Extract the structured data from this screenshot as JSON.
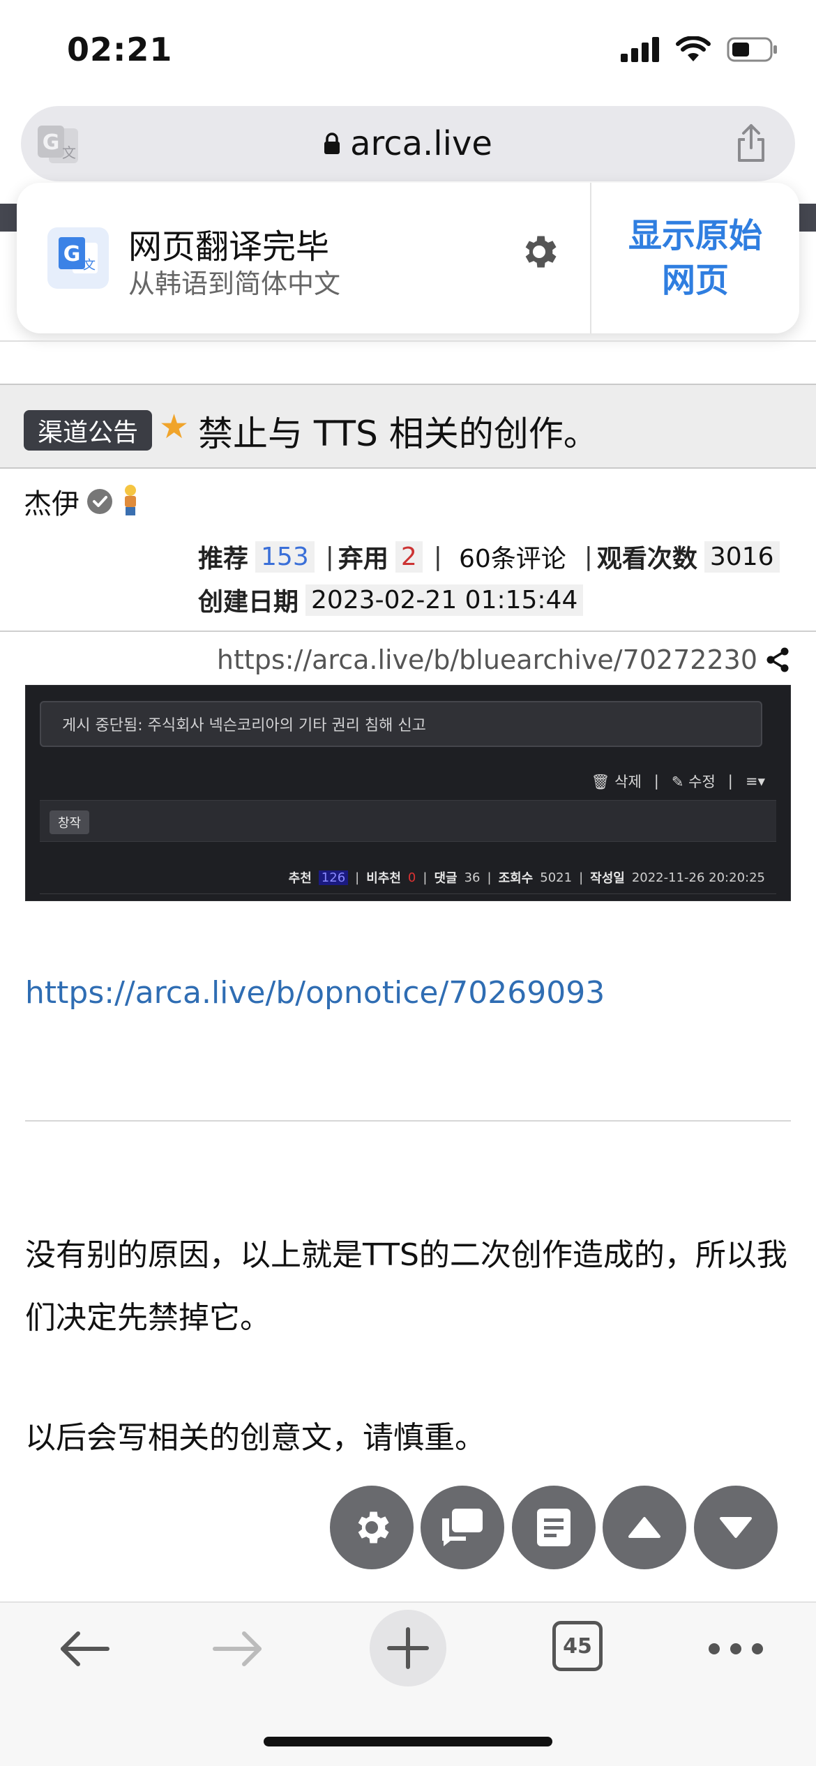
{
  "status_bar": {
    "time": "02:21"
  },
  "url_bar": {
    "domain": "arca.live"
  },
  "translate": {
    "title": "网页翻译完毕",
    "subtitle": "从韩语到简体中文",
    "show_original": "显示原始\n网页"
  },
  "notice": {
    "badge": "渠道公告",
    "title": "禁止与 TTS 相关的创作。"
  },
  "post": {
    "author": "杰伊",
    "recommend_label": "推荐",
    "recommend_count": "153",
    "downvote_label": "弃用",
    "downvote_count": "2",
    "comments": "60条评论",
    "views_label": "观看次数",
    "views_count": "3016",
    "created_label": "创建日期",
    "created_value": "2023-02-21 01:15:44",
    "link": "https://arca.live/b/bluearchive/70272230"
  },
  "embedded": {
    "banner": "게시 중단됨: 주식회사 넥슨코리아의 기타 권리 침해 신고",
    "delete": "삭제",
    "edit": "수정",
    "category": "창작",
    "rec_label": "추천",
    "rec_count": "126",
    "down_label": "비추천",
    "down_count": "0",
    "comment_label": "댓글",
    "comment_count": "36",
    "view_label": "조회수",
    "view_count": "5021",
    "date_label": "작성일",
    "date_value": "2022-11-26 20:20:25"
  },
  "content": {
    "link": "https://arca.live/b/opnotice/70269093",
    "paragraph1": "没有别的原因，以上就是TTS的二次创作造成的，所以我们决定先禁掉它。",
    "paragraph2": "以后会写相关的创意文，请慎重。"
  },
  "toolbar": {
    "tab_count": "45"
  },
  "colors": {
    "link_blue": "#2f6db3",
    "fab_gray": "#696a6e",
    "star": "#f0a42b"
  }
}
